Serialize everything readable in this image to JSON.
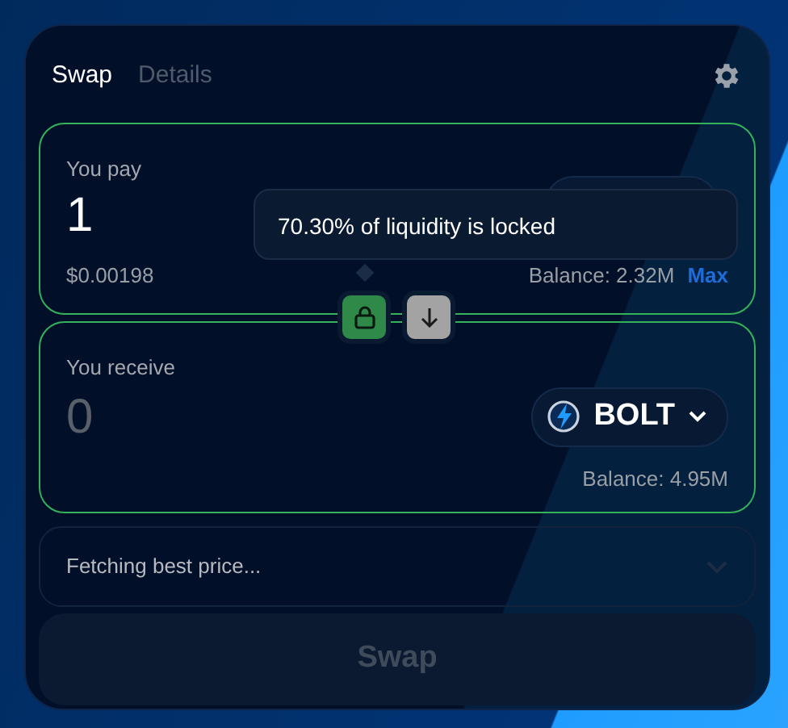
{
  "tabs": [
    {
      "label": "Swap",
      "selected": true
    },
    {
      "label": "Details",
      "selected": false
    }
  ],
  "pay": {
    "label": "You pay",
    "amount": "1",
    "usd": "$0.00198",
    "balance": "Balance: 2.32M",
    "max": "Max"
  },
  "liquidity_lock": {
    "locked": true,
    "tooltip": "70.30% of liquidity is locked"
  },
  "receive": {
    "label": "You receive",
    "amount": "0",
    "token": "BOLT",
    "balance": "Balance: 4.95M"
  },
  "route": {
    "text": "Fetching best price..."
  },
  "swap_button": {
    "label": "Swap",
    "disabled": true
  }
}
